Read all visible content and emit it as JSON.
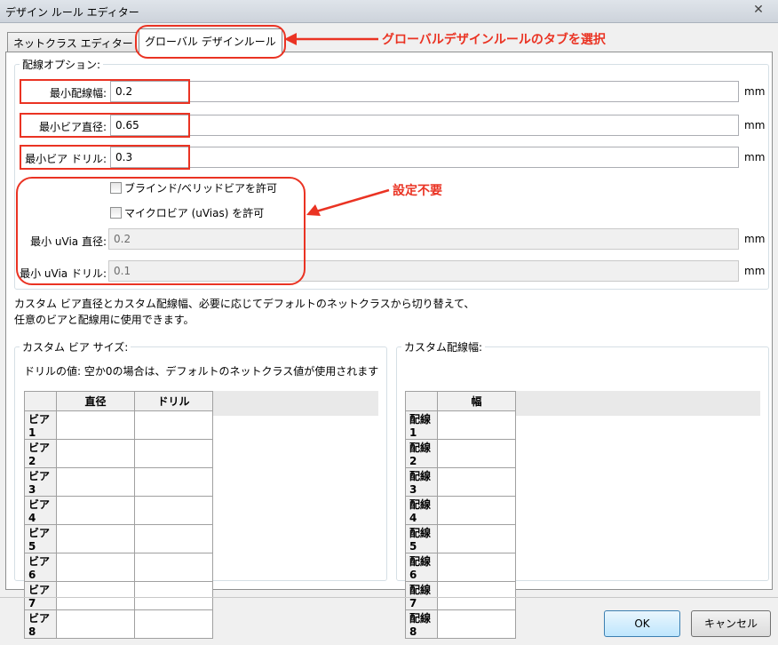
{
  "window": {
    "title": "デザイン ルール エディター",
    "close": "✕"
  },
  "tabs": [
    {
      "label": "ネットクラス エディター"
    },
    {
      "label": "グローバル デザインルール"
    }
  ],
  "routing_options": {
    "group_label": "配線オプション:",
    "unit": "mm",
    "fields": [
      {
        "label": "最小配線幅:",
        "value": "0.2"
      },
      {
        "label": "最小ビア直径:",
        "value": "0.65"
      },
      {
        "label": "最小ビア ドリル:",
        "value": "0.3"
      }
    ],
    "checkboxes": [
      {
        "label": "ブラインド/ベリッドビアを許可"
      },
      {
        "label": "マイクロビア (uVias) を許可"
      }
    ],
    "disabled_fields": [
      {
        "label": "最小 uVia 直径:",
        "value": "0.2"
      },
      {
        "label": "最小 uVia ドリル:",
        "value": "0.1"
      }
    ]
  },
  "description": {
    "line1": "カスタム ビア直径とカスタム配線幅、必要に応じてデフォルトのネットクラスから切り替えて、",
    "line2": "任意のビアと配線用に使用できます。"
  },
  "custom_via": {
    "group_label": "カスタム ビア サイズ:",
    "note": "ドリルの値: 空か0の場合は、デフォルトのネットクラス値が使用されます",
    "columns": [
      "直径",
      "ドリル"
    ],
    "rows": [
      "ビア 1",
      "ビア 2",
      "ビア 3",
      "ビア 4",
      "ビア 5",
      "ビア 6",
      "ビア 7",
      "ビア8"
    ]
  },
  "custom_track": {
    "group_label": "カスタム配線幅:",
    "columns": [
      "幅"
    ],
    "rows": [
      "配線 1",
      "配線 2",
      "配線 3",
      "配線 4",
      "配線 5",
      "配線 6",
      "配線 7",
      "配線8"
    ]
  },
  "buttons": {
    "ok": "OK",
    "cancel": "キャンセル"
  },
  "annotations": {
    "tab_note": "グローバルデザインルールのタブを選択",
    "settings_note": "設定不要",
    "color": "#ea3323"
  }
}
